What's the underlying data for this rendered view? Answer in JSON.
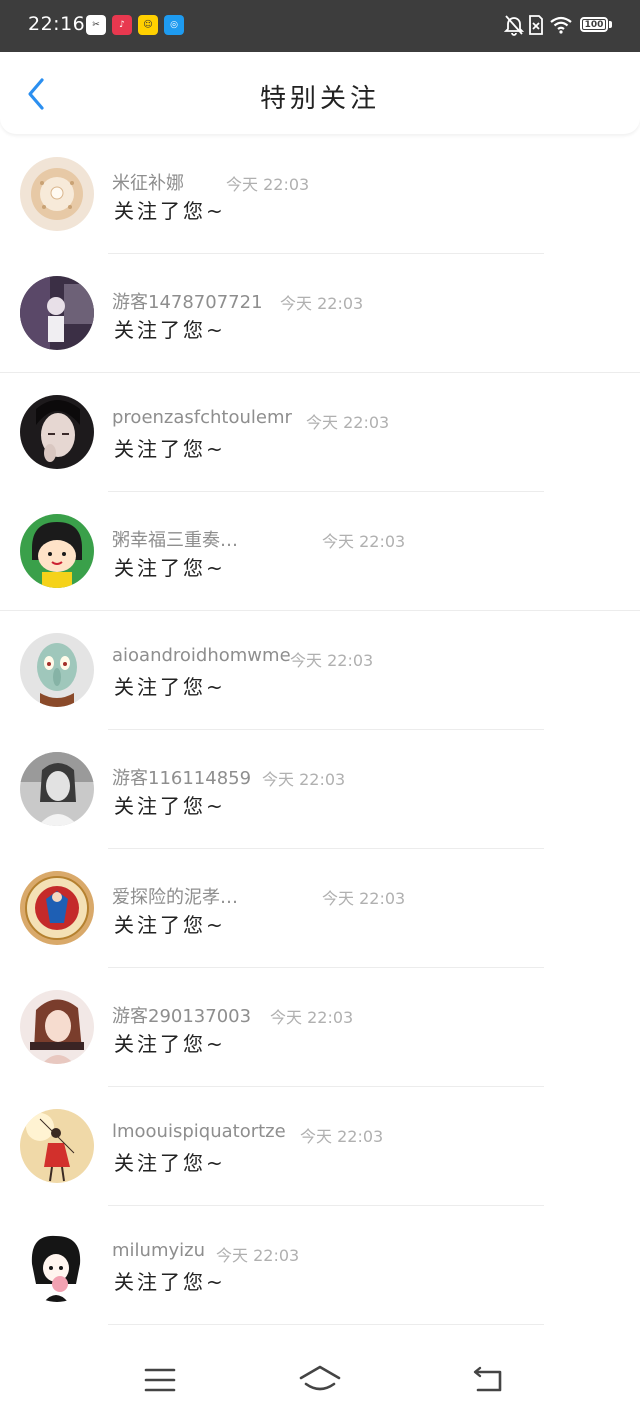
{
  "status_bar": {
    "time": "22:16",
    "battery": "100"
  },
  "header": {
    "title": "特别关注",
    "accent_color": "#2b8ff0"
  },
  "contacts": [
    {
      "name": "米征补娜",
      "time": "今天 22:03",
      "message": "关注了您~"
    },
    {
      "name": "游客1478707721",
      "time": "今天 22:03",
      "message": "关注了您~"
    },
    {
      "name": "proenzasfchtoulemr",
      "time": "今天 22:03",
      "message": "关注了您~"
    },
    {
      "name": "粥幸福三重奏…",
      "time": "今天 22:03",
      "message": "关注了您~"
    },
    {
      "name": "aioandroidhomwme",
      "time": "今天 22:03",
      "message": "关注了您~"
    },
    {
      "name": "游客116114859",
      "time": "今天 22:03",
      "message": "关注了您~"
    },
    {
      "name": "爱探险的泥孝…",
      "time": "今天 22:03",
      "message": "关注了您~"
    },
    {
      "name": "游客290137003",
      "time": "今天 22:03",
      "message": "关注了您~"
    },
    {
      "name": "lmoouispiquatortze",
      "time": "今天 22:03",
      "message": "关注了您~"
    },
    {
      "name": "milumyizu",
      "time": "今天 22:03",
      "message": "关注了您~"
    }
  ],
  "icons": {
    "back": "chevron-left-icon",
    "menu": "menu-icon",
    "home": "home-icon",
    "return": "return-icon"
  }
}
